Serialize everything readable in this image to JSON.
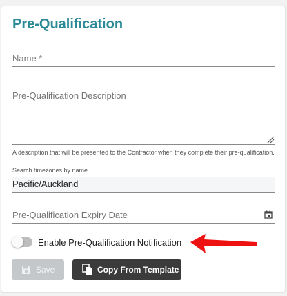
{
  "form": {
    "title": "Pre-Qualification",
    "name_placeholder": "Name *",
    "description_placeholder": "Pre-Qualification Description",
    "description_helper": "A description that will be presented to the Contractor when they complete their pre-qualification.",
    "timezone_helper": "Search timezones by name.",
    "timezone_value": "Pacific/Auckland",
    "expiry_placeholder": "Pre-Qualification Expiry Date",
    "notification_toggle": {
      "label": "Enable Pre-Qualification Notification",
      "enabled": false
    },
    "buttons": {
      "save_label": "Save",
      "save_disabled": true,
      "copy_label": "Copy From Template"
    }
  },
  "annotation": {
    "arrow_color": "#ee1111",
    "arrow_target": "notification-toggle"
  },
  "colors": {
    "title": "#2b8a96",
    "primary_button": "#3b3b3b",
    "disabled_button": "#c4c8cb"
  },
  "icons": {
    "resize": "resize-handle-icon",
    "calendar": "calendar-icon",
    "save": "save-icon",
    "copy": "copy-icon"
  }
}
